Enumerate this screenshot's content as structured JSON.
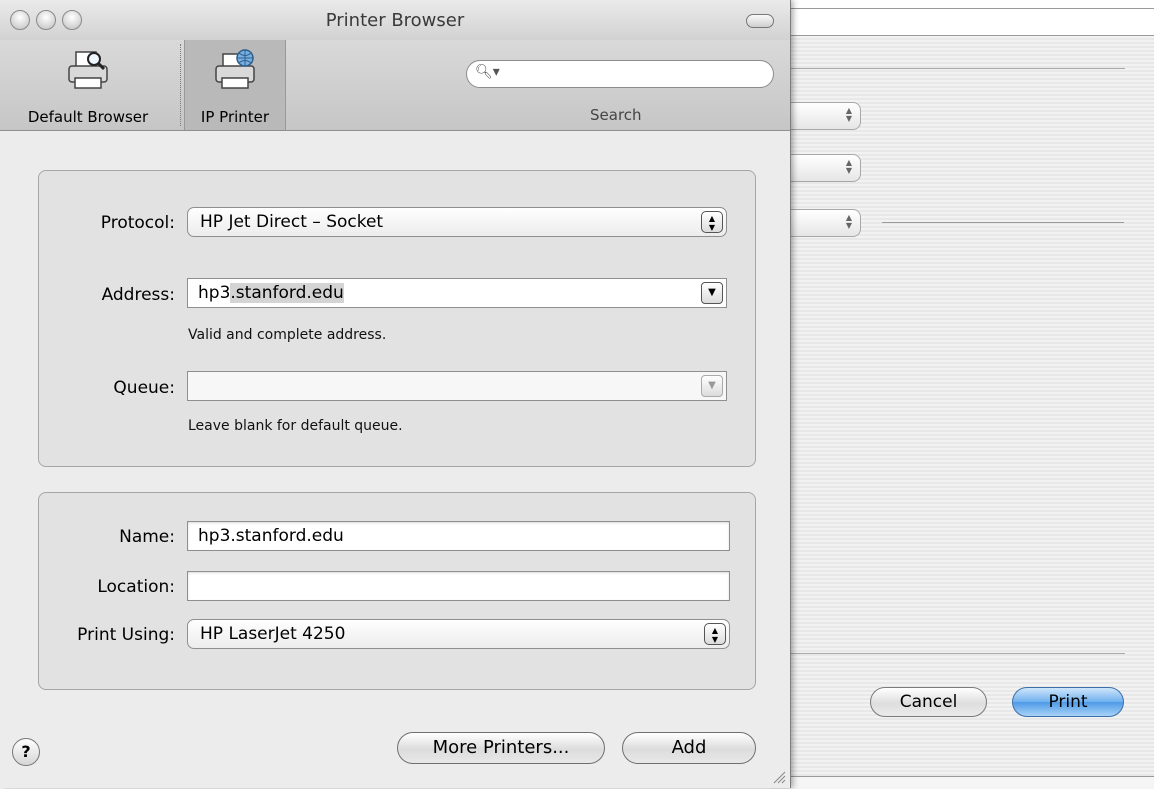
{
  "window": {
    "title": "Printer Browser"
  },
  "toolbar": {
    "items": [
      {
        "label": "Default Browser",
        "icon": "printer-magnifier-icon"
      },
      {
        "label": "IP Printer",
        "icon": "printer-globe-icon",
        "selected": true
      }
    ],
    "search": {
      "placeholder": "",
      "label": "Search"
    }
  },
  "ip_section": {
    "protocol": {
      "label": "Protocol:",
      "value": "HP Jet Direct – Socket"
    },
    "address": {
      "label": "Address:",
      "value_unselected": "hp3",
      "value_selected": ".stanford.edu",
      "hint": "Valid and complete address."
    },
    "queue": {
      "label": "Queue:",
      "value": "",
      "hint": "Leave blank for default queue."
    }
  },
  "info_section": {
    "name": {
      "label": "Name:",
      "value": "hp3.stanford.edu"
    },
    "location": {
      "label": "Location:",
      "value": ""
    },
    "print_using": {
      "label": "Print Using:",
      "value": "HP LaserJet 4250"
    }
  },
  "buttons": {
    "help": "?",
    "more_printers": "More Printers...",
    "add": "Add"
  },
  "background_dialog": {
    "cancel": "Cancel",
    "print": "Print"
  },
  "colors": {
    "accent_button": "#4f9ae6",
    "window_bg": "#ececec",
    "group_bg": "#e2e2e2"
  }
}
